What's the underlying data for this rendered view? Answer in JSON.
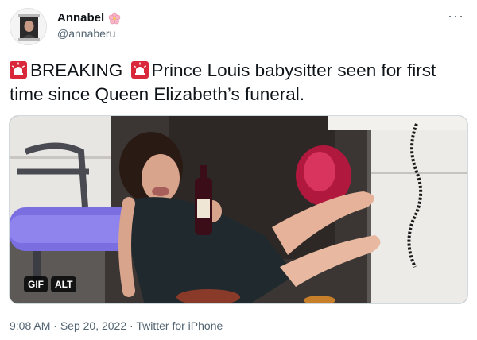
{
  "author": {
    "display_name": "Annabel",
    "handle": "@annaberu",
    "flower_icon": "cherry-blossom-icon",
    "avatar_icon": "profile-avatar"
  },
  "more_label": "···",
  "tweet": {
    "segment_1": "BREAKING",
    "segment_2": "Prince Louis babysitter seen for first time since Queen Elizabeth’s funeral.",
    "emoji_icon": "rotating-light-icon"
  },
  "media": {
    "gif_label": "GIF",
    "alt_label": "ALT"
  },
  "meta": {
    "time": "9:08 AM",
    "separator": "·",
    "date": "Sep 20, 2022",
    "source": "Twitter for iPhone"
  },
  "colors": {
    "text": "#0f1419",
    "muted": "#536471",
    "siren_red": "#d9283a"
  }
}
